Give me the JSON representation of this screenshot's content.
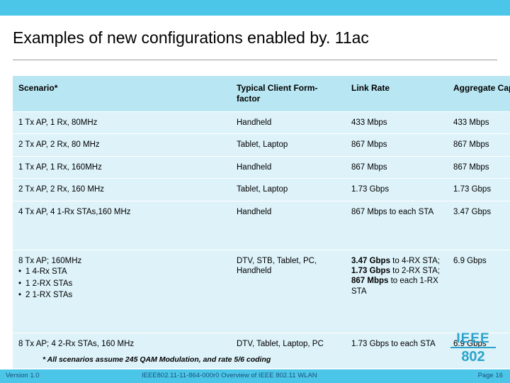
{
  "slide": {
    "title": "Examples of new configurations enabled by. 11ac",
    "footnote": "* All scenarios assume 245 QAM Modulation, and rate 5/6 coding"
  },
  "table": {
    "headers": [
      "Scenario*",
      "Typical Client Form-factor",
      "Link Rate",
      "Aggregate Capacity"
    ],
    "rows": [
      {
        "scenario": "1 Tx AP, 1 Rx, 80MHz",
        "form_factor": "Handheld",
        "link_rate": "433 Mbps",
        "aggregate": "433 Mbps"
      },
      {
        "scenario": "2 Tx AP, 2 Rx, 80 MHz",
        "form_factor": "Tablet, Laptop",
        "link_rate": "867 Mbps",
        "aggregate": "867 Mbps"
      },
      {
        "scenario": "1 Tx AP, 1 Rx, 160MHz",
        "form_factor": "Handheld",
        "link_rate": "867 Mbps",
        "aggregate": "867 Mbps"
      },
      {
        "scenario": "2 Tx AP, 2 Rx, 160 MHz",
        "form_factor": "Tablet, Laptop",
        "link_rate": "1.73 Gbps",
        "aggregate": "1.73 Gbps"
      },
      {
        "scenario": "4 Tx AP, 4 1-Rx STAs,160 MHz",
        "form_factor": "Handheld",
        "link_rate": "867 Mbps to each STA",
        "aggregate": "3.47 Gbps"
      },
      {
        "scenario": "8 Tx AP; 160MHz",
        "scenario_bullets": [
          "1 4-Rx STA",
          "1 2-RX STAs",
          "2 1-RX STAs"
        ],
        "form_factor": "DTV, STB, Tablet, PC, Handheld",
        "link_rate_parts": [
          {
            "bold": "3.47 Gbps",
            "rest": " to 4-RX STA;"
          },
          {
            "bold": "1.73 Gbps",
            "rest": " to 2-RX STA;"
          },
          {
            "bold": "867 Mbps",
            "rest": " to each 1-RX STA"
          }
        ],
        "aggregate": "6.9 Gbps"
      },
      {
        "scenario": "8 Tx AP; 4 2-Rx STAs, 160 MHz",
        "form_factor": "DTV, Tablet, Laptop, PC",
        "link_rate": "1.73 Gbps to each STA",
        "aggregate": "6.9 Gbps"
      }
    ]
  },
  "logo": {
    "line1": "IEEE",
    "line2": "802"
  },
  "footer": {
    "version": "Version 1.0",
    "doc": "IEEE802.11-11-864-000r0  Overview of IEEE 802.11 WLAN",
    "page": "Page 16"
  }
}
